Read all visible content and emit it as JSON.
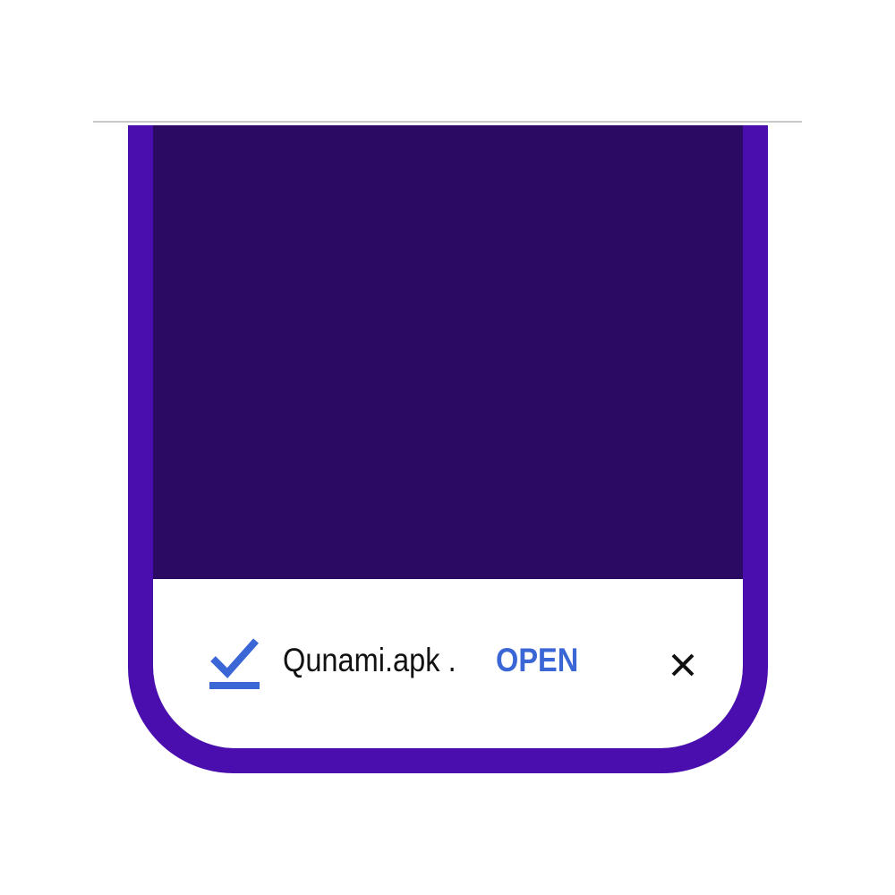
{
  "colors": {
    "frame": "#4a0eae",
    "screen": "#2b0a64",
    "accent": "#3a66d6",
    "bar_background": "#ffffff",
    "text": "#111111"
  },
  "download_bar": {
    "icon": "download-complete-check-icon",
    "file_name": "Qunami.apk .",
    "open_label": "OPEN",
    "close_icon": "close-icon"
  }
}
